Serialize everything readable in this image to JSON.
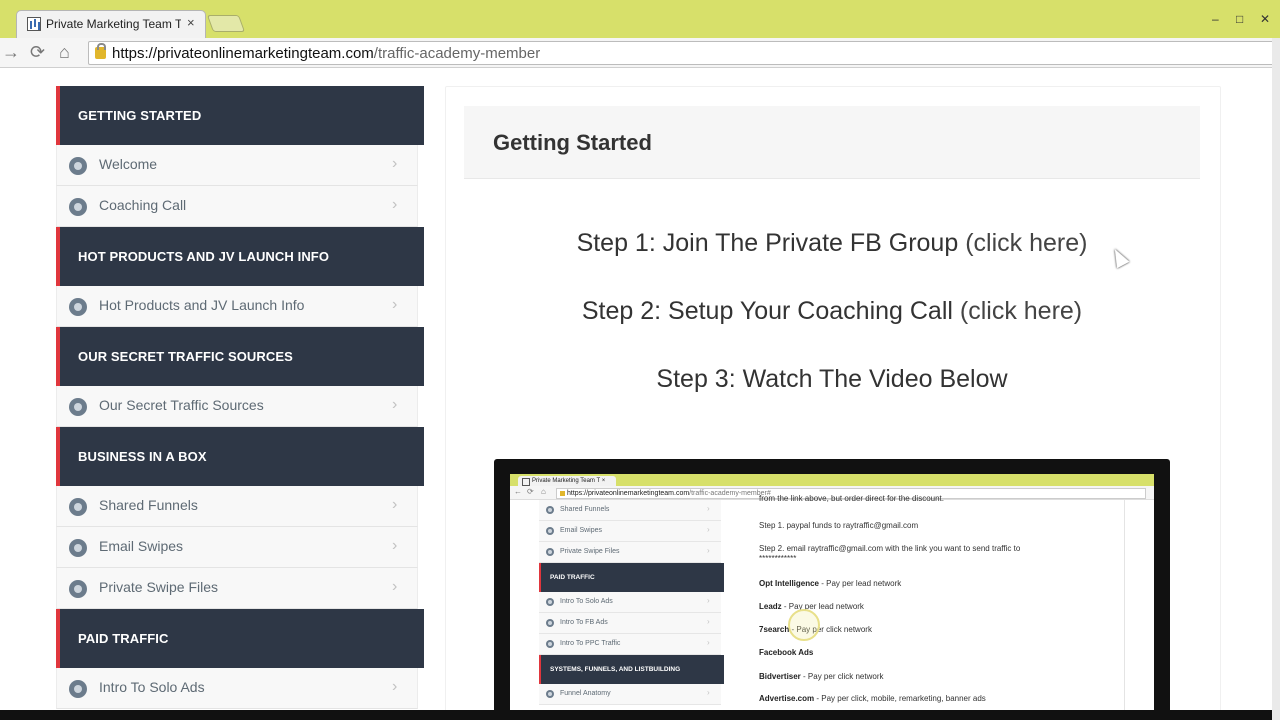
{
  "browser": {
    "tab_title": "Private Marketing Team T",
    "tab_close": "×",
    "minimize": "–",
    "maximize": "□",
    "close": "✕",
    "back": "→",
    "reload": "⟳",
    "home": "⌂",
    "url_host": "https://privateonlinemarketingteam.com",
    "url_path": "/traffic-academy-member"
  },
  "sidebar": {
    "chevron": "›",
    "sections": [
      {
        "title": "GETTING STARTED",
        "items": [
          "Welcome",
          "Coaching Call"
        ]
      },
      {
        "title": "HOT PRODUCTS AND JV LAUNCH INFO",
        "items": [
          "Hot Products and JV Launch Info"
        ]
      },
      {
        "title": "OUR SECRET TRAFFIC SOURCES",
        "items": [
          "Our Secret Traffic Sources"
        ]
      },
      {
        "title": "BUSINESS IN A BOX",
        "items": [
          "Shared Funnels",
          "Email Swipes",
          "Private Swipe Files"
        ]
      },
      {
        "title": "PAID TRAFFIC",
        "items": [
          "Intro To Solo Ads"
        ]
      }
    ]
  },
  "main": {
    "title": "Getting Started",
    "step1_text": "Step 1: Join The Private FB Group ",
    "step1_link": "(click here)",
    "step2_text": "Step 2: Setup Your Coaching Call ",
    "step2_link": "(click here)",
    "step3_text": "Step 3: Watch The Video Below"
  },
  "video": {
    "tab_title": "Private Marketing Team T ×",
    "url_host": "https://privateonlinemarketingteam.com",
    "url_path": "/traffic-academy-member#",
    "sidebar": {
      "items_a": [
        "Shared Funnels",
        "Email Swipes",
        "Private Swipe Files"
      ],
      "header_paid": "PAID TRAFFIC",
      "items_b": [
        "Intro To Solo Ads",
        "Intro To FB Ads",
        "Intro To PPC Traffic"
      ],
      "header_systems": "SYSTEMS, FUNNELS, AND LISTBUILDING",
      "items_c": [
        "Funnel Anatomy"
      ]
    },
    "lines": {
      "top_partial": "from the link above, but order direct for the discount.",
      "step1": "Step 1. paypal funds to raytraffic@gmail.com",
      "step2a": "Step 2. email raytraffic@gmail.com with the link you want to send traffic to",
      "step2b": "************",
      "opt_name": "Opt Intelligence",
      "opt_desc": " - Pay per lead network",
      "leadz_name": "Leadz",
      "leadz_desc": " - Pay per lead network",
      "search_name": "7search",
      "search_desc": " - Pay per click network",
      "fb_name": "Facebook Ads",
      "bid_name": "Bidvertiser",
      "bid_desc": " - Pay per click network",
      "adv_name": "Advertise.com",
      "adv_desc": " - Pay per click, mobile, remarketing, banner ads"
    }
  },
  "colors": {
    "titlebar": "#d7e06a",
    "sidebar_header": "#2e3746",
    "accent_red": "#e0363d"
  }
}
